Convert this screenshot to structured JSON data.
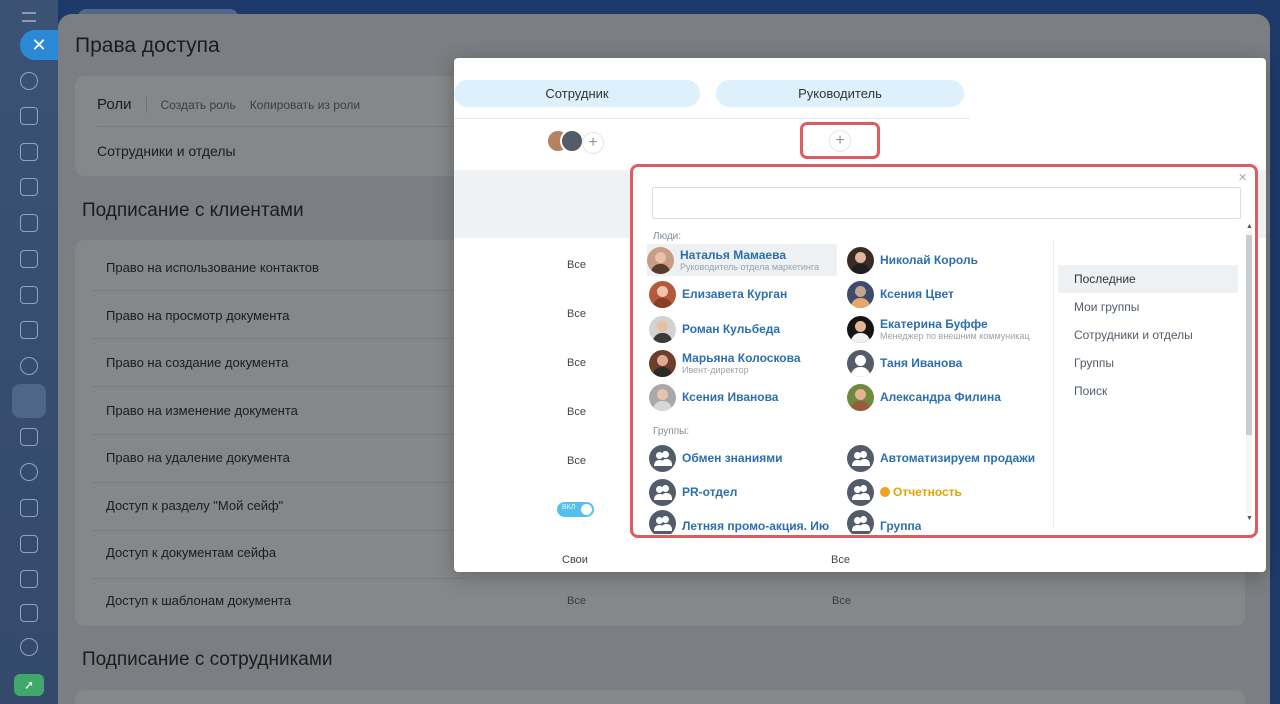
{
  "page": {
    "title": "Права доступа",
    "roles_label": "Роли",
    "create_role": "Создать роль",
    "copy_from_role": "Копировать из роли",
    "employees_and_departments": "Сотрудники и отделы",
    "section_clients": "Подписание с клиентами",
    "section_employees": "Подписание с сотрудниками",
    "permissions": [
      "Право на использование контактов",
      "Право на просмотр документа",
      "Право на создание документа",
      "Право на изменение документа",
      "Право на удаление документа",
      "Доступ к разделу \"Мой сейф\"",
      "Доступ к документам сейфа",
      "Доступ к шаблонам документа"
    ]
  },
  "popup": {
    "role_employee": "Сотрудник",
    "role_manager": "Руководитель",
    "add_symbol": "+",
    "employee_values": [
      "Все",
      "Все",
      "Все",
      "Все",
      "Все",
      "",
      "Свои",
      "Все"
    ],
    "manager_values": [
      "Все",
      "Все"
    ],
    "toggle_label": "ВКЛ"
  },
  "selector": {
    "close_symbol": "×",
    "search_value": "",
    "people_label": "Люди:",
    "groups_label": "Группы:",
    "people": [
      {
        "name": "Наталья Мамаева",
        "subtitle": "Руководитель отдела маркетинга",
        "skin": "#d8a98a",
        "hair": "#5a3a2a"
      },
      {
        "name": "Николай Король",
        "subtitle": "",
        "skin": "#e0b69a",
        "hair": "#2a1d16"
      },
      {
        "name": "Елизавета Курган",
        "subtitle": "",
        "skin": "#efc1a6",
        "hair": "#8a3e22"
      },
      {
        "name": "Ксения Цвет",
        "subtitle": "",
        "skin": "#f2c7ad",
        "hair": "#3c4b6e"
      },
      {
        "name": "Роман Кульбеда",
        "subtitle": "",
        "skin": "#e8bfa4",
        "hair": "#3a3a3a"
      },
      {
        "name": "Екатерина Буффе",
        "subtitle": "Менеджер по внешним коммуникациям",
        "skin": "#e4b597",
        "hair": "#141414"
      },
      {
        "name": "Марьяна Колоскова",
        "subtitle": "Ивент-директор",
        "skin": "#deab8f",
        "hair": "#5b2e1c"
      },
      {
        "name": "Таня Иванова",
        "subtitle": "",
        "skin": "#ffffff",
        "hair": "#535c69"
      },
      {
        "name": "Ксения Иванова",
        "subtitle": "",
        "skin": "#e9c4ad",
        "hair": "#8e8e8e"
      },
      {
        "name": "Александра Филина",
        "subtitle": "",
        "skin": "#e6b295",
        "hair": "#6e8a3c"
      }
    ],
    "groups": [
      {
        "name": "Обмен знаниями",
        "orange": false
      },
      {
        "name": "Автоматизируем продажи",
        "orange": false
      },
      {
        "name": "PR-отдел",
        "orange": false
      },
      {
        "name": "Отчетность",
        "orange": true
      },
      {
        "name": "Летняя промо-акция. Ию",
        "orange": false
      },
      {
        "name": "Группа",
        "orange": false
      }
    ],
    "tabs": [
      "Последние",
      "Мои группы",
      "Сотрудники и отделы",
      "Группы",
      "Поиск"
    ],
    "scroll_up": "▲",
    "scroll_down": "▼"
  },
  "colors": {
    "accent": "#2a8ad8",
    "highlight": "#e05a61",
    "role_pill": "#dcf1fb",
    "link": "#2d6fae",
    "toggle": "#55c0ee"
  }
}
